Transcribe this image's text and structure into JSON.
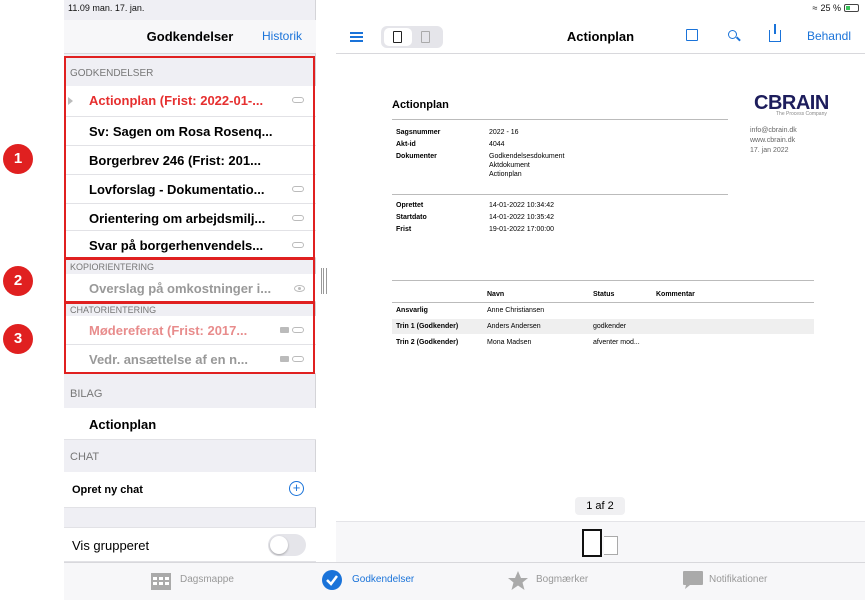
{
  "status_bar": {
    "time_date": "11.09  man. 17. jan.",
    "battery": "25 %"
  },
  "left_nav": {
    "title": "Godkendelser",
    "history": "Historik"
  },
  "sections": {
    "godkendelser": "GODKENDELSER",
    "kopiorientering": "KOPIORIENTERING",
    "chatorientering": "CHATORIENTERING",
    "bilag": "BILAG",
    "chat": "CHAT"
  },
  "approvals": [
    {
      "title": "Actionplan (Frist: 2022-01-...",
      "state": "selected"
    },
    {
      "title": "Sv: Sagen om Rosa Rosenq..."
    },
    {
      "title": "Borgerbrev 246 (Frist: 201..."
    },
    {
      "title": "Lovforslag - Dokumentatio..."
    },
    {
      "title": "Orientering om arbejdsmilj..."
    },
    {
      "title": "Svar på borgerhenvendels..."
    }
  ],
  "copy_orientation": [
    {
      "title": "Overslag på omkostninger i..."
    }
  ],
  "chat_orientation": [
    {
      "title": "Mødereferat (Frist: 2017..."
    },
    {
      "title": "Vedr. ansættelse af en n..."
    }
  ],
  "attachments": [
    {
      "title": "Actionplan"
    }
  ],
  "chat": {
    "new_chat": "Opret ny chat"
  },
  "group_toggle": {
    "label": "Vis grupperet",
    "on": false
  },
  "callouts": [
    "1",
    "2",
    "3"
  ],
  "right_nav": {
    "title": "Actionplan",
    "action": "Behandl"
  },
  "document": {
    "heading": "Actionplan",
    "logo": "CBRAIN",
    "logo_tagline": "The Process Company",
    "contact": [
      "info@cbrain.dk",
      "www.cbrain.dk",
      "17. jan 2022"
    ],
    "meta": [
      {
        "label": "Sagsnummer",
        "value": "2022 - 16"
      },
      {
        "label": "Akt-id",
        "value": "4044"
      },
      {
        "label": "Dokumenter",
        "value": "Godkendelsesdokument"
      }
    ],
    "documents_extra": [
      "Aktdokument",
      "Actionplan"
    ],
    "dates": [
      {
        "label": "Oprettet",
        "value": "14-01-2022 10:34:42"
      },
      {
        "label": "Startdato",
        "value": "14-01-2022 10:35:42"
      },
      {
        "label": "Frist",
        "value": "19-01-2022 17:00:00"
      }
    ],
    "table_headers": [
      "Navn",
      "Status",
      "Kommentar"
    ],
    "table_rows": [
      {
        "role": "Ansvarlig",
        "name": "Anne Christiansen",
        "status": ""
      },
      {
        "role": "Trin 1 (Godkender)",
        "name": "Anders Andersen",
        "status": "godkender"
      },
      {
        "role": "Trin 2 (Godkender)",
        "name": "Mona Madsen",
        "status": "afventer mod..."
      }
    ]
  },
  "pager": {
    "label": "1 af 2"
  },
  "tabs": [
    {
      "label": "Dagsmappe",
      "active": false
    },
    {
      "label": "Godkendelser",
      "active": true
    },
    {
      "label": "Bogmærker",
      "active": false
    },
    {
      "label": "Notifikationer",
      "active": false
    }
  ],
  "colors": {
    "accent": "#1a73d9",
    "red": "#e02020",
    "deadline_red": "#e62f2f"
  }
}
